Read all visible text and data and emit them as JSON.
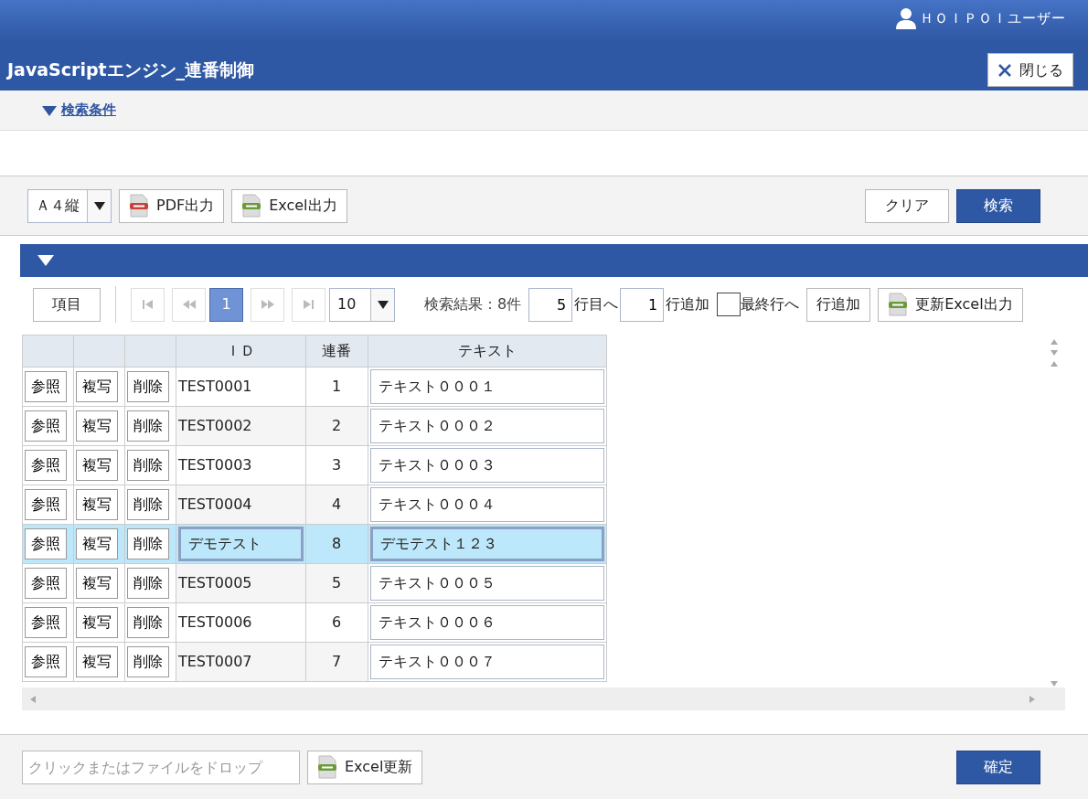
{
  "header": {
    "user": "ＨＯＩＰＯＩユーザー",
    "title": "JavaScriptエンジン_連番制御",
    "close_button": "閉じる"
  },
  "search_conditions": {
    "label": "検索条件",
    "expanded": true
  },
  "toolbar": {
    "paper": "Ａ４縦",
    "buttons": [
      {
        "label": "PDF出力",
        "kind": "pdf"
      },
      {
        "label": "Excel出力",
        "kind": "excel"
      }
    ],
    "right_buttons": [
      {
        "label": "クリア",
        "kind": "plain"
      },
      {
        "label": "検索",
        "kind": "primary"
      }
    ]
  },
  "results": {
    "expanded": true,
    "items_button": "項目",
    "pages": [
      {
        "label": "1",
        "selected": true
      }
    ],
    "page_size": "10",
    "result_count": "検索結果：8件",
    "goto_row": "5",
    "goto_label": "行目へ",
    "add_count": "1",
    "add_label": "行追加",
    "last_row": {
      "label": "最終行へ",
      "checked": false
    },
    "add_button": "行追加",
    "export_button": "更新Excel出力"
  },
  "table": {
    "columns": [
      "",
      "",
      "",
      "ＩＤ",
      "連番",
      "テキスト"
    ],
    "rows": [
      {
        "actions": [
          "参照",
          "複写",
          "削除"
        ],
        "id": "TEST0001",
        "seq": "1",
        "text": "テキスト０００１",
        "selected": false
      },
      {
        "actions": [
          "参照",
          "複写",
          "削除"
        ],
        "id": "TEST0002",
        "seq": "2",
        "text": "テキスト０００２",
        "selected": false
      },
      {
        "actions": [
          "参照",
          "複写",
          "削除"
        ],
        "id": "TEST0003",
        "seq": "3",
        "text": "テキスト０００３",
        "selected": false
      },
      {
        "actions": [
          "参照",
          "複写",
          "削除"
        ],
        "id": "TEST0004",
        "seq": "4",
        "text": "テキスト０００４",
        "selected": false
      },
      {
        "actions": [
          "参照",
          "複写",
          "削除"
        ],
        "id": "デモテスト",
        "seq": "8",
        "text": "デモテスト１２３",
        "selected": true
      },
      {
        "actions": [
          "参照",
          "複写",
          "削除"
        ],
        "id": "TEST0005",
        "seq": "5",
        "text": "テキスト０００５",
        "selected": false
      },
      {
        "actions": [
          "参照",
          "複写",
          "削除"
        ],
        "id": "TEST0006",
        "seq": "6",
        "text": "テキスト０００６",
        "selected": false
      },
      {
        "actions": [
          "参照",
          "複写",
          "削除"
        ],
        "id": "TEST0007",
        "seq": "7",
        "text": "テキスト０００７",
        "selected": false
      }
    ]
  },
  "footer": {
    "file_drop": {
      "placeholder": "クリックまたはファイルをドロップ"
    },
    "excel_update": "Excel更新",
    "confirm": "確定"
  }
}
